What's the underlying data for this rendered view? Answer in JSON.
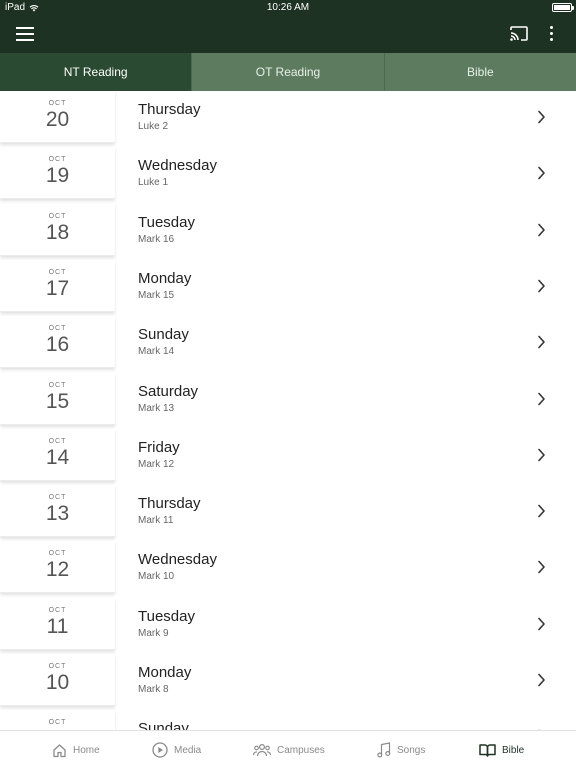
{
  "status_bar": {
    "carrier": "iPad",
    "time": "10:26 AM"
  },
  "tabs": [
    {
      "label": "NT Reading",
      "active": true
    },
    {
      "label": "OT Reading",
      "active": false
    },
    {
      "label": "Bible",
      "active": false
    }
  ],
  "readings": [
    {
      "month": "OCT",
      "day": "20",
      "weekday": "Thursday",
      "passage": "Luke 2"
    },
    {
      "month": "OCT",
      "day": "19",
      "weekday": "Wednesday",
      "passage": "Luke 1"
    },
    {
      "month": "OCT",
      "day": "18",
      "weekday": "Tuesday",
      "passage": "Mark 16"
    },
    {
      "month": "OCT",
      "day": "17",
      "weekday": "Monday",
      "passage": "Mark 15"
    },
    {
      "month": "OCT",
      "day": "16",
      "weekday": "Sunday",
      "passage": "Mark 14"
    },
    {
      "month": "OCT",
      "day": "15",
      "weekday": "Saturday",
      "passage": "Mark 13"
    },
    {
      "month": "OCT",
      "day": "14",
      "weekday": "Friday",
      "passage": "Mark 12"
    },
    {
      "month": "OCT",
      "day": "13",
      "weekday": "Thursday",
      "passage": "Mark 11"
    },
    {
      "month": "OCT",
      "day": "12",
      "weekday": "Wednesday",
      "passage": "Mark 10"
    },
    {
      "month": "OCT",
      "day": "11",
      "weekday": "Tuesday",
      "passage": "Mark 9"
    },
    {
      "month": "OCT",
      "day": "10",
      "weekday": "Monday",
      "passage": "Mark 8"
    },
    {
      "month": "OCT",
      "day": "",
      "weekday": "Sunday",
      "passage": ""
    }
  ],
  "bottom_nav": [
    {
      "label": "Home",
      "icon": "home-icon",
      "active": false
    },
    {
      "label": "Media",
      "icon": "play-circle-icon",
      "active": false
    },
    {
      "label": "Campuses",
      "icon": "people-icon",
      "active": false
    },
    {
      "label": "Songs",
      "icon": "music-note-icon",
      "active": false
    },
    {
      "label": "Bible",
      "icon": "book-icon",
      "active": true
    }
  ],
  "colors": {
    "app_bar": "#1e3224",
    "tab_active": "#2a4a32",
    "tab_inactive": "#5d7c5f"
  }
}
